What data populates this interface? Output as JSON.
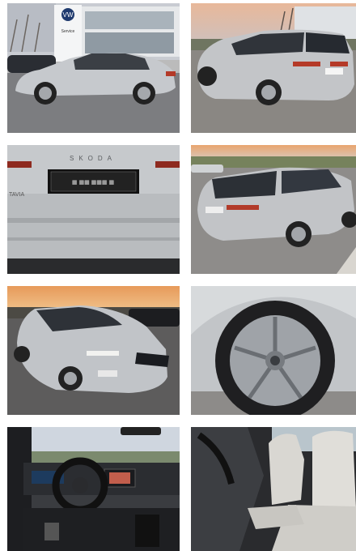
{
  "gallery": {
    "photos": [
      {
        "subject": "front-left-side-view"
      },
      {
        "subject": "rear-right-three-quarter-view"
      },
      {
        "subject": "tailgate-close-up"
      },
      {
        "subject": "rear-three-quarter-elevated-view"
      },
      {
        "subject": "front-three-quarter-sunset-view"
      },
      {
        "subject": "alloy-wheel-close-up"
      },
      {
        "subject": "cockpit-dashboard-view"
      },
      {
        "subject": "front-seats-view"
      }
    ],
    "dealer_sign": {
      "brand_mark": "VW",
      "label": "Service"
    },
    "tailgate": {
      "badge": "SKODA",
      "model_fragment": "TAVIA"
    }
  }
}
